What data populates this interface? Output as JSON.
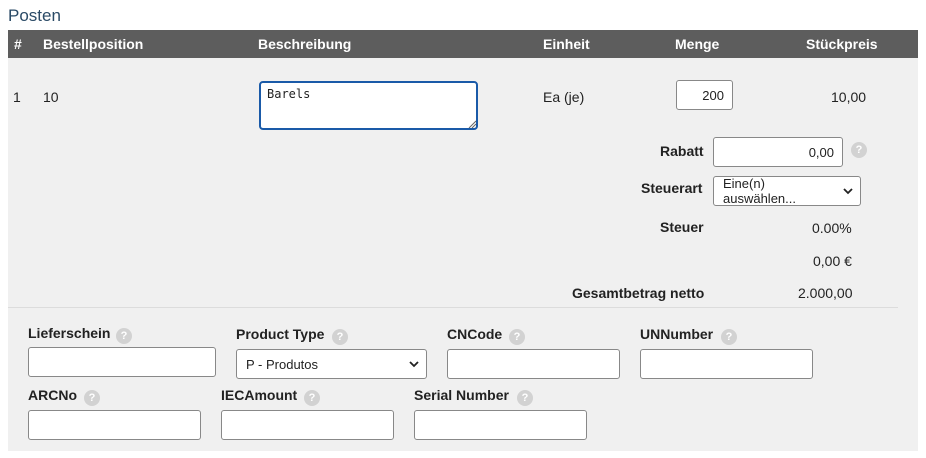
{
  "section_title": "Posten",
  "table": {
    "headers": [
      "#",
      "Bestellposition",
      "Beschreibung",
      "Einheit",
      "Menge",
      "Stückpreis"
    ],
    "row": {
      "index": "1",
      "position": "10",
      "description": "Barels",
      "unit": "Ea (je)",
      "quantity": "200",
      "unit_price": "10,00"
    }
  },
  "summary": {
    "discount_label": "Rabatt",
    "discount_value": "0,00",
    "tax_type_label": "Steuerart",
    "tax_type_selected": "Eine(n) auswählen...",
    "tax_label": "Steuer",
    "tax_rate": "0.00%",
    "tax_amount": "0,00 €",
    "net_total_label": "Gesamtbetrag netto",
    "net_total_value": "2.000,00"
  },
  "extra_fields": {
    "delivery_note_label": "Lieferschein",
    "delivery_note_value": "",
    "product_type_label": "Product Type",
    "product_type_selected": "P - Produtos",
    "cncode_label": "CNCode",
    "cncode_value": "",
    "unnumber_label": "UNNumber",
    "unnumber_value": "",
    "arcno_label": "ARCNo",
    "arcno_value": "",
    "iecamount_label": "IECAmount",
    "iecamount_value": "",
    "serial_number_label": "Serial Number",
    "serial_number_value": ""
  },
  "icons": {
    "help": "question-mark-icon",
    "select": "chevron-down-icon"
  },
  "colors": {
    "header_bg": "#5d5d5d",
    "body_bg": "#f0f0f0",
    "focus_border": "#1a5aa8",
    "title": "#2a4a66"
  }
}
